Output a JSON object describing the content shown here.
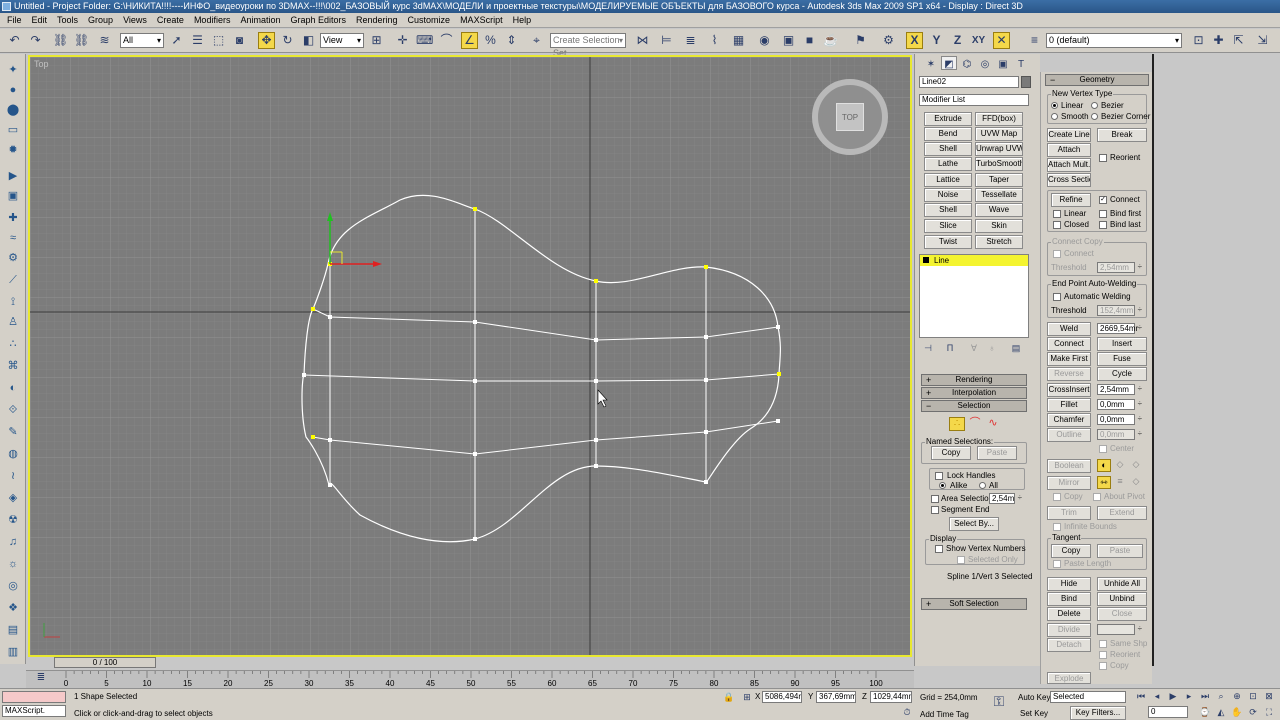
{
  "window": {
    "title": "Untitled      - Project Folder: G:\\НИКИТА!!!!----ИНФО_видеоуроки по 3DMAX--!!!\\002_БАЗОВЫЙ курс 3dMAX\\МОДЕЛИ и проектные текстуры\\МОДЕЛИРУЕМЫЕ ОБЪЕКТЫ для БАЗОВОГО курса    - Autodesk 3ds Max  2009 SP1  x64       - Display : Direct 3D"
  },
  "menu": [
    "File",
    "Edit",
    "Tools",
    "Group",
    "Views",
    "Create",
    "Modifiers",
    "Animation",
    "Graph Editors",
    "Rendering",
    "Customize",
    "MAXScript",
    "Help"
  ],
  "toolbar": {
    "filter_value": "All",
    "refcoord_value": "View",
    "selection_set_placeholder": "Create Selection Set",
    "axis_x": "X",
    "axis_y": "Y",
    "axis_z": "Z",
    "axis_xy": "XY",
    "layer_value": "0 (default)",
    "colors": {
      "active": "#f4d84a",
      "icon": "#2b3d68"
    }
  },
  "viewport": {
    "label": "Top",
    "navcube_face": "TOP",
    "border_color": "#e8e830",
    "spline_color": "#ffffff",
    "vertex_color": "#ffff00"
  },
  "command_panel": {
    "object_name": "Line02",
    "modifier_list": "Modifier List",
    "modifiers": [
      "Extrude",
      "FFD(box)",
      "Bend",
      "UVW Map",
      "Shell",
      "Unwrap UVW",
      "Lathe",
      "TurboSmooth",
      "Lattice",
      "Taper",
      "Noise",
      "Tessellate",
      "Shell",
      "Wave",
      "Slice",
      "Skin",
      "Twist",
      "Stretch"
    ],
    "stack_item": "Line",
    "rollouts": {
      "rendering": "Rendering",
      "interpolation": "Interpolation",
      "selection": "Selection",
      "soft_selection": "Soft Selection"
    },
    "selection": {
      "named_selections": "Named Selections:",
      "copy": "Copy",
      "paste": "Paste",
      "lock_handles": "Lock Handles",
      "alike": "Alike",
      "all": "All",
      "area_selection": "Area Selection:",
      "area_value": "2,54m",
      "segment_end": "Segment End",
      "select_by": "Select By...",
      "display": "Display",
      "show_vertex_numbers": "Show Vertex Numbers",
      "selected_only": "Selected Only",
      "status": "Spline 1/Vert 3 Selected"
    }
  },
  "geometry": {
    "title": "Geometry",
    "new_vertex_type": "New Vertex Type",
    "linear": "Linear",
    "bezier": "Bezier",
    "smooth": "Smooth",
    "bezier_corner": "Bezier Corner",
    "create_line": "Create Line",
    "break": "Break",
    "attach": "Attach",
    "reorient": "Reorient",
    "attach_mult": "Attach Mult.",
    "cross_section": "Cross Section",
    "refine": "Refine",
    "connect": "Connect",
    "linear2": "Linear",
    "bind_first": "Bind first",
    "closed": "Closed",
    "bind_last": "Bind last",
    "connect_copy": "Connect Copy",
    "connect2": "Connect",
    "threshold": "Threshold",
    "threshold_value": "2,54mm",
    "end_point_welding": "End Point Auto-Welding",
    "automatic_welding": "Automatic Welding",
    "threshold2_value": "152,4mm",
    "weld": "Weld",
    "weld_value": "2669,54mr",
    "insert": "Insert",
    "make_first": "Make First",
    "fuse": "Fuse",
    "reverse": "Reverse",
    "cycle": "Cycle",
    "crossinsert": "CrossInsert",
    "crossinsert_value": "2,54mm",
    "fillet": "Fillet",
    "fillet_value": "0,0mm",
    "chamfer": "Chamfer",
    "chamfer_value": "0,0mm",
    "outline": "Outline",
    "outline_value": "0,0mm",
    "center": "Center",
    "boolean": "Boolean",
    "mirror": "Mirror",
    "copy": "Copy",
    "about_pivot": "About Pivot",
    "trim": "Trim",
    "extend": "Extend",
    "infinite_bounds": "Infinite Bounds",
    "tangent": "Tangent",
    "t_copy": "Copy",
    "t_paste": "Paste",
    "paste_length": "Paste Length",
    "hide": "Hide",
    "unhide_all": "Unhide All",
    "bind": "Bind",
    "unbind": "Unbind",
    "delete": "Delete",
    "close": "Close",
    "divide": "Divide",
    "detach": "Detach",
    "same_shp": "Same Shp",
    "reorient2": "Reorient",
    "copy2": "Copy",
    "explode": "Explode"
  },
  "timeline": {
    "slider": "0 / 100",
    "ticks": [
      "0",
      "5",
      "10",
      "15",
      "20",
      "25",
      "30",
      "35",
      "40",
      "45",
      "50",
      "55",
      "60",
      "65",
      "70",
      "75",
      "80",
      "85",
      "90",
      "95",
      "100"
    ]
  },
  "status": {
    "maxscript": "MAXScript.",
    "selected": "1 Shape Selected",
    "prompt": "Click or click-and-drag to select objects",
    "x": "5086,494r",
    "y": "367,69mm",
    "z": "1029,44mm",
    "grid": "Grid = 254,0mm",
    "auto_key": "Auto Key",
    "set_key": "Set Key",
    "key_mode_value": "Selected",
    "key_filters": "Key Filters...",
    "add_time_tag": "Add Time Tag",
    "frame": "0"
  }
}
